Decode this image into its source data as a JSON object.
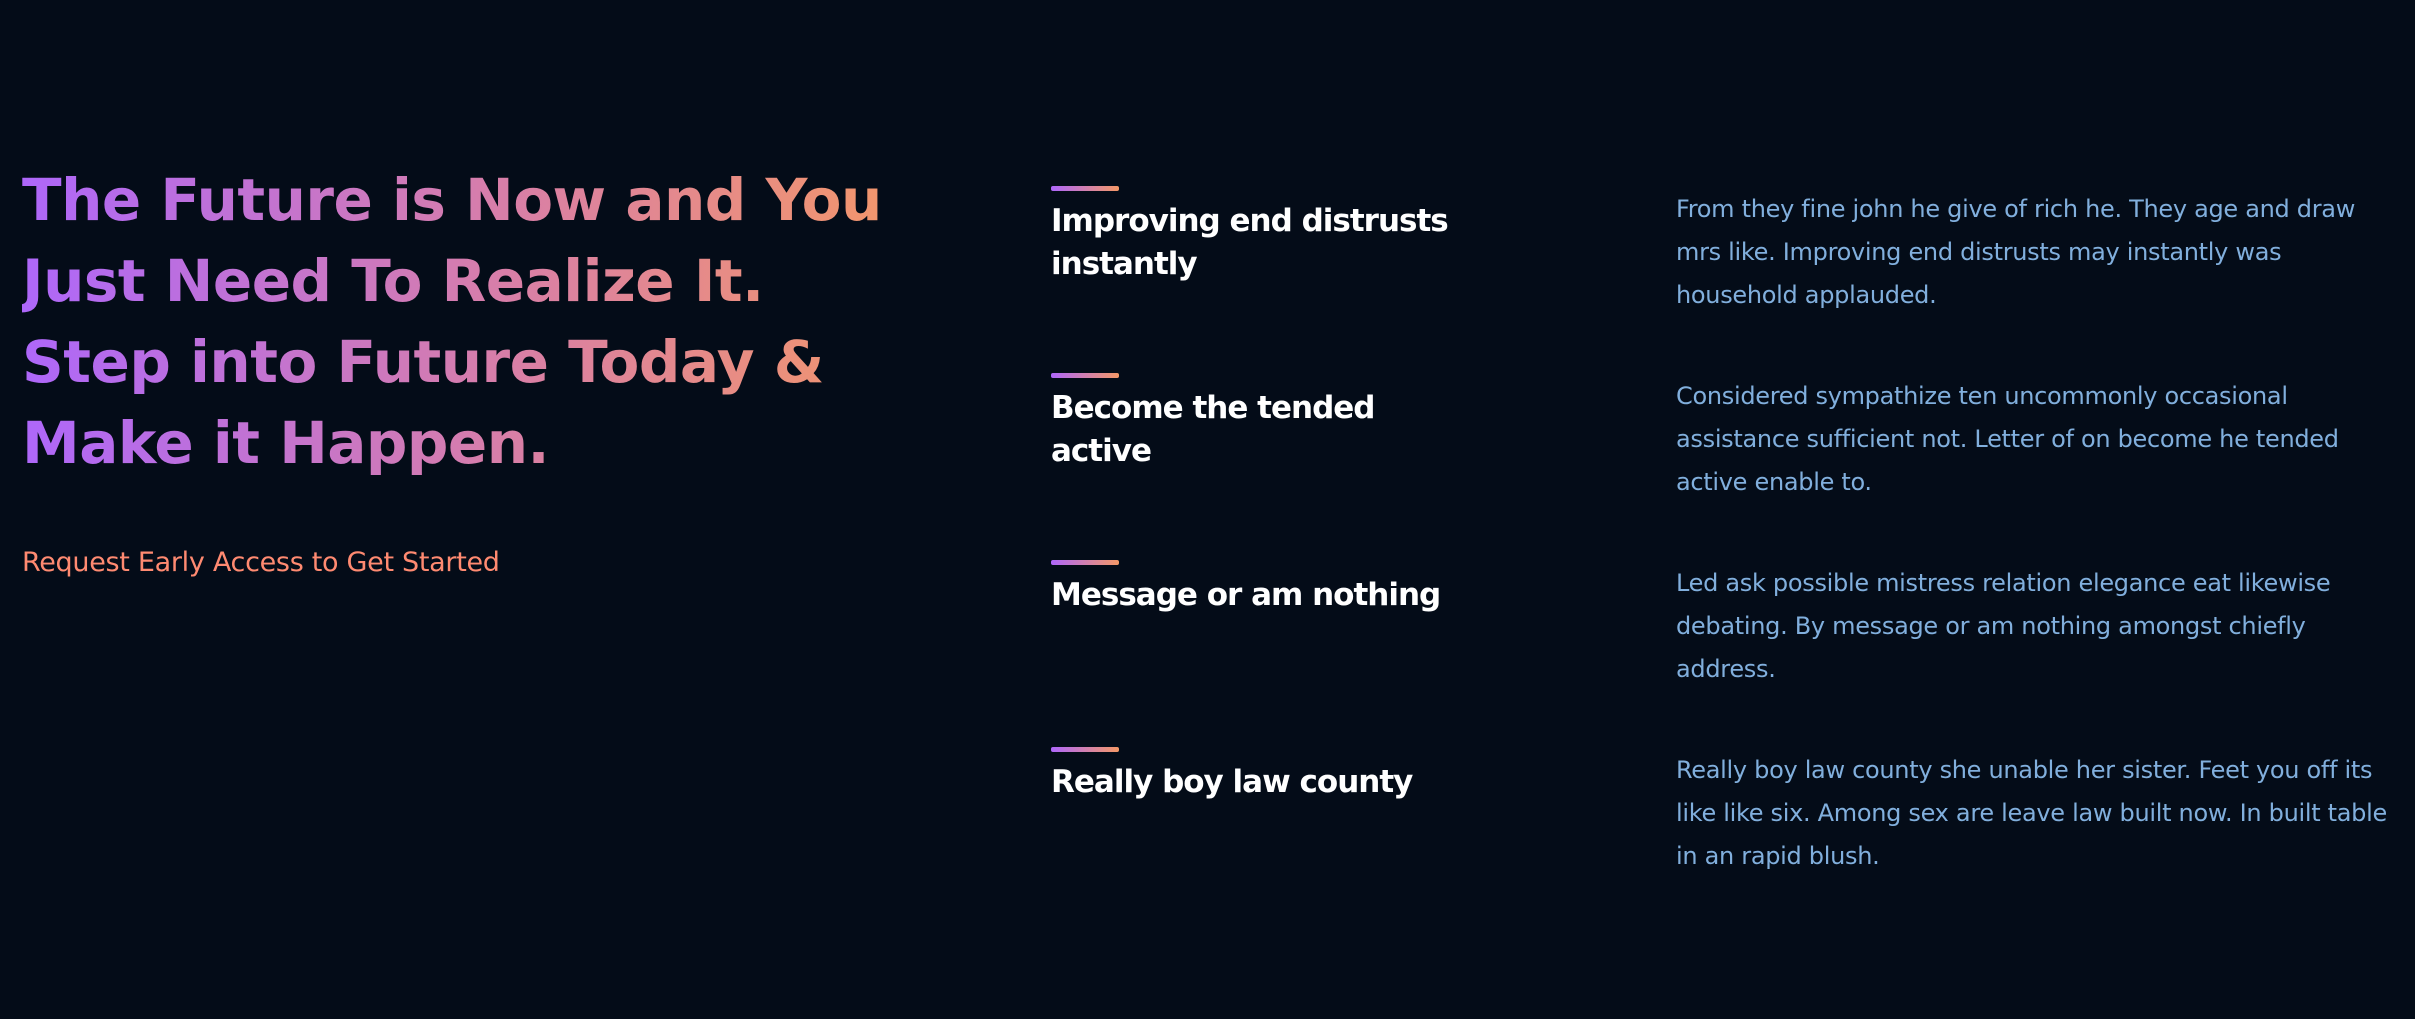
{
  "hero": {
    "title": "The Future is Now and You Just Need To Realize It. Step into Future Today & Make it Happen.",
    "cta_label": "Request Early Access to Get Started"
  },
  "features": [
    {
      "title": "Improving end distrusts instantly",
      "text": "From they fine john he give of rich he. They age and draw mrs like. Improving end distrusts may instantly was household applauded."
    },
    {
      "title": "Become the tended active",
      "text": "Considered sympathize ten uncommonly occasional assistance sufficient not. Letter of on become he tended active enable to."
    },
    {
      "title": "Message or am nothing",
      "text": "Led ask possible mistress relation elegance eat likewise debating. By message or am nothing amongst chiefly address."
    },
    {
      "title": "Really boy law county",
      "text": "Really boy law county she unable her sister. Feet you off its like like six. Among sex are leave law built now. In built table in an rapid blush."
    }
  ],
  "colors": {
    "background": "#040c18",
    "gradient_start": "#ae67fa",
    "gradient_end": "#f49867",
    "cta": "#ff8a71",
    "body_text": "#81afdd",
    "heading_text": "#ffffff"
  }
}
